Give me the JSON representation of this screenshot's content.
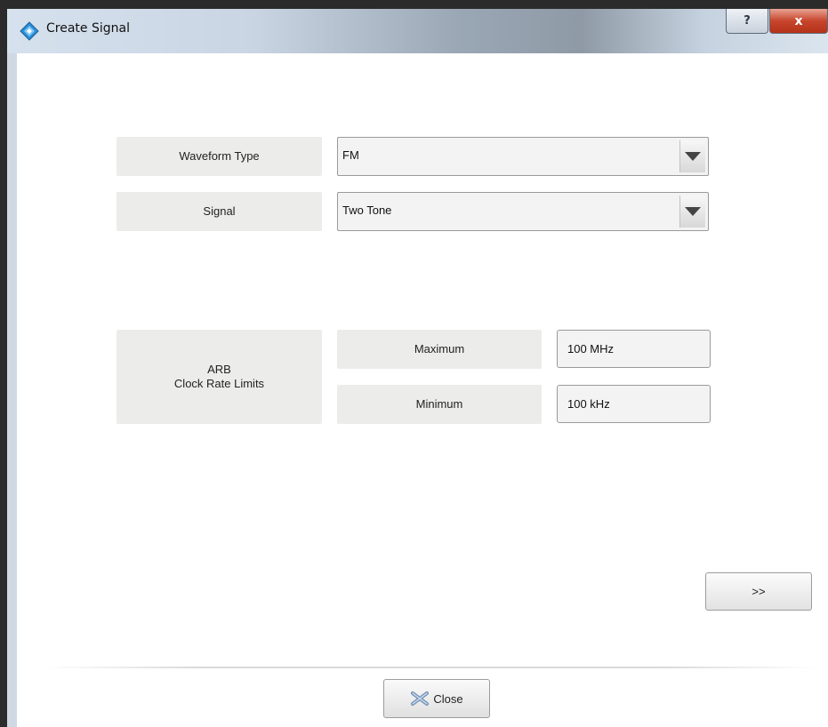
{
  "window": {
    "title": "Create Signal",
    "help_label": "?",
    "close_label": "x"
  },
  "form": {
    "waveform_type_label": "Waveform Type",
    "waveform_type_value": "FM",
    "signal_label": "Signal",
    "signal_value": "Two Tone",
    "arb_label": "ARB\nClock Rate Limits",
    "maximum_label": "Maximum",
    "maximum_value": "100 MHz",
    "minimum_label": "Minimum",
    "minimum_value": "100 kHz"
  },
  "buttons": {
    "next_label": ">>",
    "close_label": "Close"
  },
  "icons": {
    "app": "app-diamond-icon",
    "dropdown": "chevron-down-icon",
    "close": "close-icon"
  },
  "colors": {
    "label_bg": "#ececea",
    "field_bg": "#f3f3f3",
    "close_button_red": "#c7452c"
  }
}
